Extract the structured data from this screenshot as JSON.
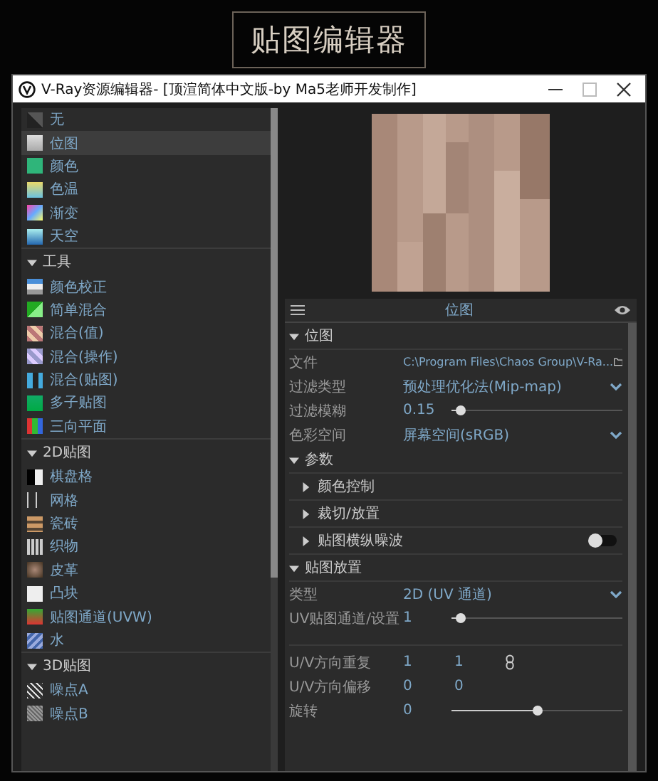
{
  "banner": {
    "title": "贴图编辑器"
  },
  "window": {
    "title": "V-Ray资源编辑器- [顶渲简体中文版-by Ma5老师开发制作]"
  },
  "sidebar": {
    "groups": [
      {
        "items": [
          {
            "label": "无",
            "selected": false
          },
          {
            "label": "位图",
            "selected": true
          },
          {
            "label": "颜色",
            "selected": false
          },
          {
            "label": "色温",
            "selected": false
          },
          {
            "label": "渐变",
            "selected": false
          },
          {
            "label": "天空",
            "selected": false
          }
        ]
      },
      {
        "label": "工具",
        "expanded": true,
        "items": [
          {
            "label": "颜色校正",
            "selected": false
          },
          {
            "label": "简单混合",
            "selected": false
          },
          {
            "label": "混合(值)",
            "selected": false
          },
          {
            "label": "混合(操作)",
            "selected": false
          },
          {
            "label": "混合(贴图)",
            "selected": false
          },
          {
            "label": "多子贴图",
            "selected": false
          },
          {
            "label": "三向平面",
            "selected": false
          }
        ]
      },
      {
        "label": "2D贴图",
        "expanded": true,
        "items": [
          {
            "label": "棋盘格",
            "selected": false
          },
          {
            "label": "网格",
            "selected": false
          },
          {
            "label": "瓷砖",
            "selected": false
          },
          {
            "label": "织物",
            "selected": false
          },
          {
            "label": "皮革",
            "selected": false
          },
          {
            "label": "凸块",
            "selected": false
          },
          {
            "label": "贴图通道(UVW)",
            "selected": false
          },
          {
            "label": "水",
            "selected": false
          }
        ]
      },
      {
        "label": "3D贴图",
        "expanded": true,
        "items": [
          {
            "label": "噪点A",
            "selected": false
          },
          {
            "label": "噪点B",
            "selected": false
          }
        ]
      }
    ]
  },
  "panel": {
    "title": "位图",
    "sections": [
      {
        "label": "位图",
        "expanded": true,
        "rows": [
          {
            "kind": "path",
            "label": "文件",
            "value": "C:\\Program Files\\Chaos Group\\V-Ra..."
          },
          {
            "kind": "dropdown",
            "label": "过滤类型",
            "value": "预处理优化法(Mip-map)"
          },
          {
            "kind": "slider",
            "label": "过滤模糊",
            "value": "0.15",
            "level": 0.05
          },
          {
            "kind": "dropdown",
            "label": "色彩空间",
            "value": "屏幕空间(sRGB)"
          }
        ]
      },
      {
        "label": "参数",
        "expanded": true,
        "subsections": [
          {
            "label": "颜色控制",
            "expanded": false
          },
          {
            "label": "裁切/放置",
            "expanded": false
          },
          {
            "label": "贴图横纵噪波",
            "expanded": false,
            "toggle": {
              "on": false
            }
          }
        ]
      },
      {
        "label": "贴图放置",
        "expanded": true,
        "rows": [
          {
            "kind": "dropdown",
            "label": "类型",
            "value": "2D (UV 通道)"
          },
          {
            "kind": "slider",
            "label": "UV贴图通道/设置",
            "value": "1",
            "level": 0.05
          },
          {
            "kind": "spacer"
          },
          {
            "kind": "pair",
            "label": "U/V方向重复",
            "values": [
              "1",
              "1"
            ],
            "linked": true
          },
          {
            "kind": "pair",
            "label": "U/V方向偏移",
            "values": [
              "0",
              "0"
            ],
            "linked": false
          },
          {
            "kind": "slider",
            "label": "旋转",
            "value": "0",
            "level": 0.5
          }
        ]
      }
    ]
  }
}
